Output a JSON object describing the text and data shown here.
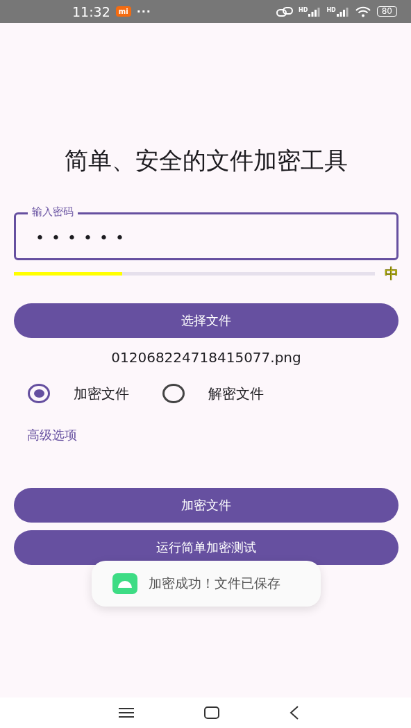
{
  "status_bar": {
    "time": "11:32",
    "app_badge": "mi",
    "more": "···",
    "signals": [
      {
        "label": "HD"
      },
      {
        "label": "HD"
      }
    ],
    "battery": "80"
  },
  "title": "简单、安全的文件加密工具",
  "password_field": {
    "label": "输入密码",
    "value": "••••••"
  },
  "strength": {
    "level": 0.3,
    "label": "中",
    "color": "#ffff00"
  },
  "select_button": "选择文件",
  "file_name": "012068224718415077.png",
  "modes": [
    {
      "label": "加密文件",
      "selected": true
    },
    {
      "label": "解密文件",
      "selected": false
    }
  ],
  "advanced_link": "高级选项",
  "action_buttons": [
    "加密文件",
    "运行简单加密测试"
  ],
  "toast": {
    "message": "加密成功！文件已保存"
  }
}
